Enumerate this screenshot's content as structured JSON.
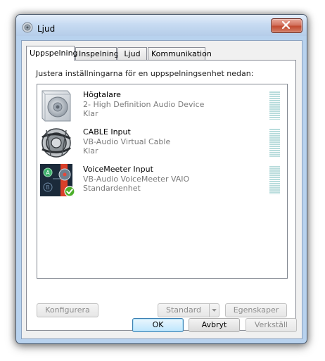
{
  "window": {
    "title": "Ljud",
    "close_label": "x"
  },
  "tabs": [
    {
      "label": "Uppspelning",
      "active": true
    },
    {
      "label": "Inspelning",
      "active": false
    },
    {
      "label": "Ljud",
      "active": false
    },
    {
      "label": "Kommunikation",
      "active": false
    }
  ],
  "playback": {
    "instruction": "Justera inställningarna för en uppspelningsenhet nedan:",
    "devices": [
      {
        "name": "Högtalare",
        "description": "2- High Definition Audio Device",
        "status": "Klar",
        "icon": "speaker-icon"
      },
      {
        "name": "CABLE Input",
        "description": "VB-Audio Virtual Cable",
        "status": "Klar",
        "icon": "cable-speaker-icon"
      },
      {
        "name": "VoiceMeeter Input",
        "description": "VB-Audio VoiceMeeter VAIO",
        "status": "Standardenhet",
        "icon": "voicemeeter-icon",
        "default_badge": "check-icon"
      }
    ],
    "buttons": {
      "configure": "Konfigurera",
      "set_default": "Standard",
      "properties": "Egenskaper"
    }
  },
  "dialog_buttons": {
    "ok": "OK",
    "cancel": "Avbryt",
    "apply": "Verkställ"
  },
  "colors": {
    "selection_meter": "#b8dcdc",
    "default_check": "#4caf2a",
    "voicemeeter_red": "#d9402a"
  }
}
